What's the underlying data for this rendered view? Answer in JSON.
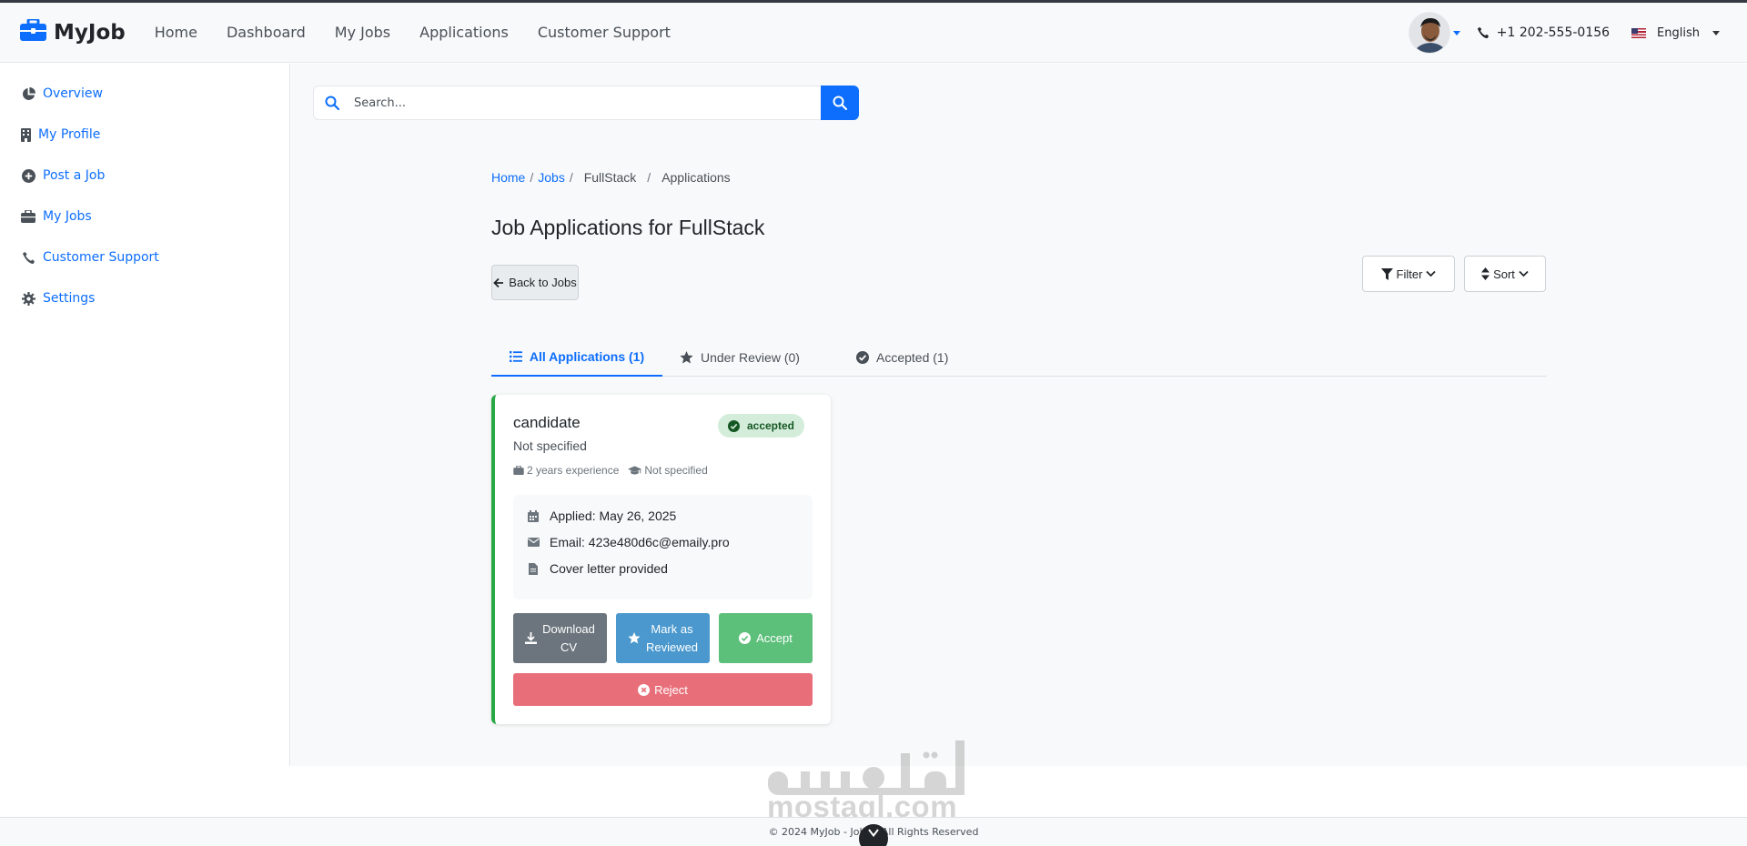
{
  "header": {
    "brand": "MyJob",
    "nav": [
      "Home",
      "Dashboard",
      "My Jobs",
      "Applications",
      "Customer Support"
    ],
    "phone": "+1 202-555-0156",
    "language": "English"
  },
  "sidebar": {
    "items": [
      {
        "label": "Overview",
        "icon": "pie-chart-icon"
      },
      {
        "label": "My Profile",
        "icon": "building-icon"
      },
      {
        "label": "Post a Job",
        "icon": "plus-circle-icon"
      },
      {
        "label": "My Jobs",
        "icon": "briefcase-icon"
      },
      {
        "label": "Customer Support",
        "icon": "phone-icon"
      },
      {
        "label": "Settings",
        "icon": "gear-icon"
      }
    ]
  },
  "search": {
    "placeholder": "Search...",
    "value": ""
  },
  "breadcrumb": [
    "Home",
    "Jobs",
    "FullStack",
    "Applications"
  ],
  "page_title": "Job Applications for FullStack",
  "toolbar": {
    "back": "Back to Jobs",
    "filter": "Filter",
    "sort": "Sort"
  },
  "tabs": [
    {
      "label": "All Applications (1)",
      "icon": "list-icon",
      "active": true
    },
    {
      "label": "Under Review (0)",
      "icon": "star-icon",
      "active": false
    },
    {
      "label": "Accepted (1)",
      "icon": "check-circle-icon",
      "active": false
    }
  ],
  "application": {
    "name": "candidate",
    "subtitle": "Not specified",
    "status": "accepted",
    "experience": "2 years experience",
    "education": "Not specified",
    "applied": "Applied: May 26, 2025",
    "email": "Email: 423e480d6c@emaily.pro",
    "cover_letter": "Cover letter provided",
    "actions": {
      "download_line1": "Download",
      "download_line2": "CV",
      "review_line1": "Mark as",
      "review_line2": "Reviewed",
      "accept": "Accept",
      "reject": "Reject"
    }
  },
  "footer": {
    "text": "© 2024 MyJob - Job ... All Rights Reserved"
  },
  "watermark": {
    "text": "mostaql.com"
  },
  "colors": {
    "primary": "#0d6efd",
    "accepted_border": "#28a745",
    "reject": "#e86f7a",
    "accept": "#5cbf7a",
    "review": "#4a98cd",
    "download": "#6c757d"
  }
}
